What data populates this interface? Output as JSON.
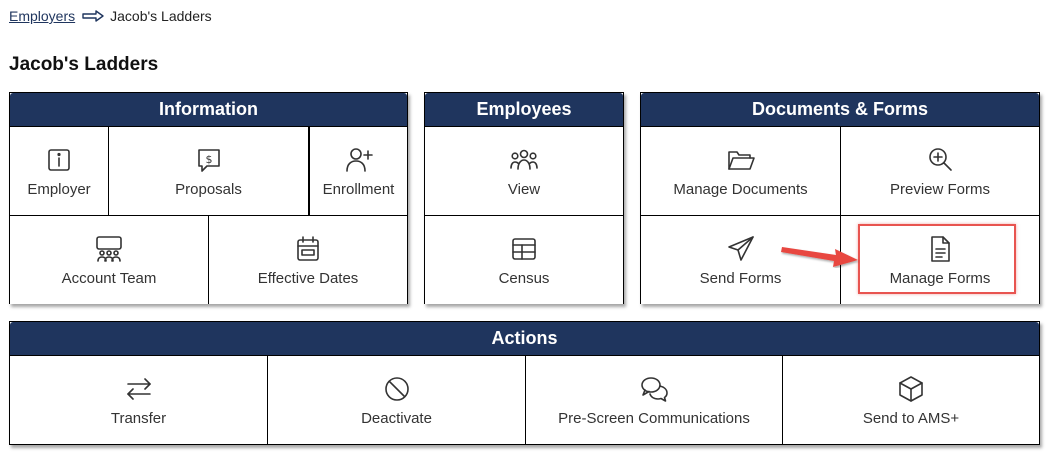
{
  "breadcrumb": {
    "parent": "Employers",
    "current": "Jacob's Ladders"
  },
  "page_title": "Jacob's Ladders",
  "information": {
    "title": "Information",
    "tiles": [
      {
        "label": "Employer",
        "icon": "info-icon"
      },
      {
        "label": "Proposals",
        "icon": "proposal-icon"
      },
      {
        "label": "Enrollment",
        "icon": "add-user-icon"
      },
      {
        "label": "Account Team",
        "icon": "team-icon"
      },
      {
        "label": "Effective Dates",
        "icon": "calendar-icon"
      }
    ]
  },
  "employees": {
    "title": "Employees",
    "tiles": [
      {
        "label": "View",
        "icon": "people-icon"
      },
      {
        "label": "Census",
        "icon": "table-icon"
      }
    ]
  },
  "documents": {
    "title": "Documents & Forms",
    "tiles": [
      {
        "label": "Manage Documents",
        "icon": "folder-icon"
      },
      {
        "label": "Preview Forms",
        "icon": "zoom-in-icon"
      },
      {
        "label": "Send Forms",
        "icon": "paper-plane-icon"
      },
      {
        "label": "Manage Forms",
        "icon": "document-icon"
      }
    ]
  },
  "actions": {
    "title": "Actions",
    "tiles": [
      {
        "label": "Transfer",
        "icon": "transfer-icon"
      },
      {
        "label": "Deactivate",
        "icon": "block-icon"
      },
      {
        "label": "Pre-Screen Communications",
        "icon": "chat-icon"
      },
      {
        "label": "Send to AMS+",
        "icon": "cube-icon"
      }
    ]
  },
  "colors": {
    "header": "#1f355e",
    "highlight": "#e85450"
  }
}
